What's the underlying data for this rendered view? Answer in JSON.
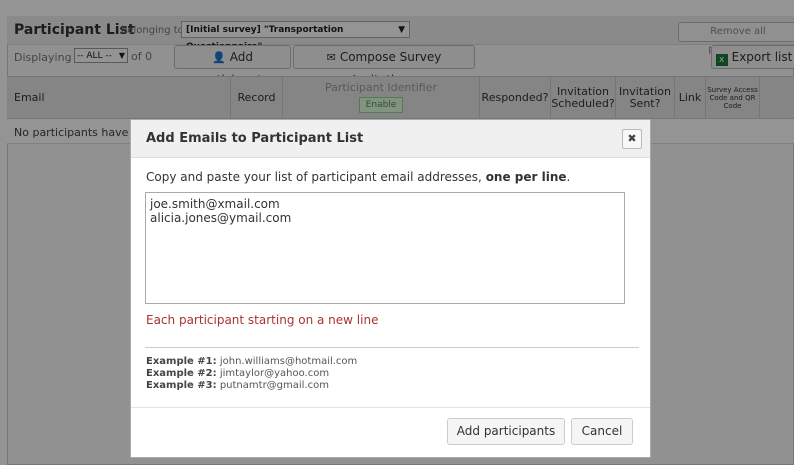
{
  "header": {
    "title": "Participant List",
    "belonging_to": "belonging to",
    "survey_select": "[Initial survey] \"Transportation Questionnaire\"",
    "remove_all_label": "Remove all participants"
  },
  "toolbar": {
    "displaying_label": "Displaying",
    "range_select": "-- ALL --",
    "of_count": "of 0",
    "add_participants_label": "Add participants",
    "compose_label": "Compose Survey Invitations",
    "export_label": "Export list"
  },
  "table": {
    "columns": {
      "email": "Email",
      "record": "Record",
      "participant_identifier": "Participant Identifier",
      "enable": "Enable",
      "responded": "Responded?",
      "invitation_scheduled": "Invitation Scheduled?",
      "invitation_sent": "Invitation Sent?",
      "link": "Link",
      "access_code": "Survey Access Code and QR Code"
    },
    "empty_text": "No participants have b"
  },
  "dialog": {
    "title": "Add Emails to Participant List",
    "close_glyph": "✖",
    "instruction_prefix": "Copy and paste your list of participant email addresses,",
    "instruction_bold": "one per line",
    "instruction_suffix": ".",
    "emails_value": "joe.smith@xmail.com\nalicia.jones@ymail.com",
    "hint": "Each participant starting on a new line",
    "examples": [
      {
        "label": "Example #1:",
        "value": "john.williams@hotmail.com"
      },
      {
        "label": "Example #2:",
        "value": "jimtaylor@yahoo.com"
      },
      {
        "label": "Example #3:",
        "value": "putnamtr@gmail.com"
      }
    ],
    "add_button": "Add participants",
    "cancel_button": "Cancel"
  },
  "colors": {
    "overlay": "#000000",
    "hint_red": "#aa3333",
    "enable_green": "#558855"
  }
}
